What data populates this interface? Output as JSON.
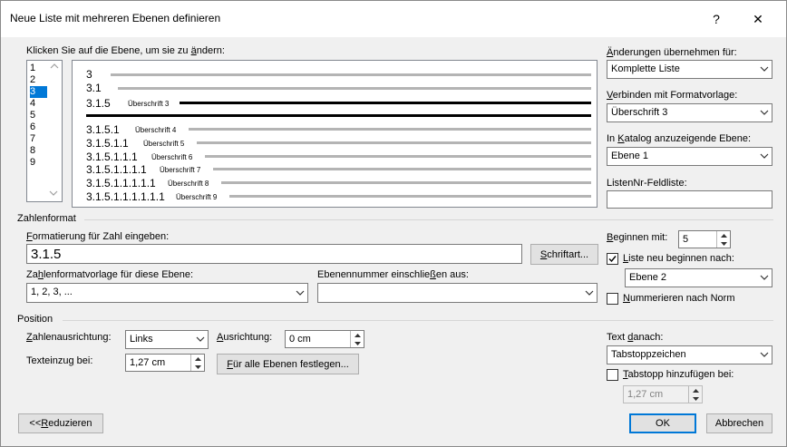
{
  "window": {
    "title": "Neue Liste mit mehreren Ebenen definieren",
    "help": "?",
    "close": "✕"
  },
  "level_select": {
    "label_prefix": "Klicken Sie auf die Ebene, um sie zu ",
    "label_key": "ä",
    "label_suffix": "ndern:",
    "items": [
      "1",
      "2",
      "3",
      "4",
      "5",
      "6",
      "7",
      "8",
      "9"
    ],
    "selected": "3"
  },
  "preview": {
    "rows": [
      {
        "num": "3",
        "label": ""
      },
      {
        "num": "3.1",
        "label": ""
      },
      {
        "num": "3.1.5",
        "label": "Überschrift 3"
      },
      {
        "num": "3.1.5.1",
        "label": "Überschrift 4"
      },
      {
        "num": "3.1.5.1.1",
        "label": "Überschrift 5"
      },
      {
        "num": "3.1.5.1.1.1",
        "label": "Überschrift 6"
      },
      {
        "num": "3.1.5.1.1.1.1",
        "label": "Überschrift 7"
      },
      {
        "num": "3.1.5.1.1.1.1.1",
        "label": "Überschrift 8"
      },
      {
        "num": "3.1.5.1.1.1.1.1.1",
        "label": "Überschrift 9"
      }
    ]
  },
  "right_panel": {
    "apply_label_key": "Ä",
    "apply_label_rest": "nderungen übernehmen für:",
    "apply_value": "Komplette Liste",
    "link_label_key": "V",
    "link_label_rest": "erbinden mit Formatvorlage:",
    "link_value": "Überschrift 3",
    "gallery_label_pre": "In ",
    "gallery_label_key": "K",
    "gallery_label_rest": "atalog anzuzeigende Ebene:",
    "gallery_value": "Ebene 1",
    "listnum_label": "ListenNr-Feldliste:",
    "listnum_value": ""
  },
  "number_format": {
    "section": "Zahlenformat",
    "format_label_key": "F",
    "format_label_rest": "ormatierung für Zahl eingeben:",
    "format_value": "3.1.5",
    "font_button_key": "S",
    "font_button_rest": "chriftart...",
    "style_label_pre": "Za",
    "style_label_key": "h",
    "style_label_rest": "lenformatvorlage für diese Ebene:",
    "style_value": "1, 2, 3, ...",
    "include_label_pre": "Ebenennummer einschlie",
    "include_label_key": "ß",
    "include_label_rest": "en aus:",
    "include_value": "",
    "start_label_key": "B",
    "start_label_rest": "eginnen mit:",
    "start_value": "5",
    "restart_label_key": "L",
    "restart_label_rest": "iste neu beginnen nach:",
    "restart_checked": true,
    "restart_value": "Ebene 2",
    "legal_label_key": "N",
    "legal_label_rest": "ummerieren nach Norm",
    "legal_checked": false
  },
  "position": {
    "section": "Position",
    "align_label_key": "Z",
    "align_label_rest": "ahlenausrichtung:",
    "align_value": "Links",
    "aligned_label_key": "A",
    "aligned_label_rest": "usrichtung:",
    "aligned_value": "0 cm",
    "indent_label_pre": "Texteinzu",
    "indent_label_key": "g",
    "indent_label_rest": " bei:",
    "indent_value": "1,27 cm",
    "set_all_key": "F",
    "set_all_rest": "ür alle Ebenen festlegen...",
    "follow_label_pre": "Text ",
    "follow_label_key": "d",
    "follow_label_rest": "anach:",
    "follow_value": "Tabstoppzeichen",
    "tab_label_key": "T",
    "tab_label_rest": "abstopp hinzufügen bei:",
    "tab_checked": false,
    "tab_value": "1,27 cm"
  },
  "footer": {
    "less_pre": "<< ",
    "less_key": "R",
    "less_rest": "eduzieren",
    "ok": "OK",
    "cancel": "Abbrechen"
  },
  "colors": {
    "accent": "#0078d7",
    "bg": "#f0f0f0"
  }
}
